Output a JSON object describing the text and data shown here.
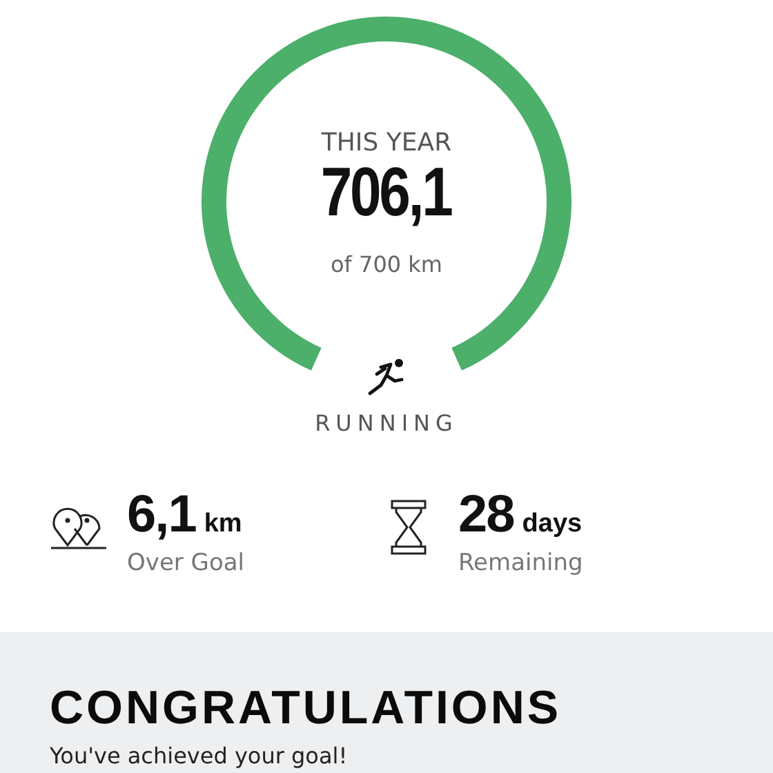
{
  "goal": {
    "period": "THIS YEAR",
    "value": "706,1",
    "target": "of 700 km",
    "activity": "RUNNING"
  },
  "stats": [
    {
      "kind": "pins",
      "value": "6,1",
      "unit": "km",
      "caption": "Over Goal"
    },
    {
      "kind": "hourglass",
      "value": "28",
      "unit": "days",
      "caption": "Remaining"
    }
  ],
  "banner": {
    "title": "CONGRATULATIONS",
    "message": "You've achieved your goal!"
  }
}
